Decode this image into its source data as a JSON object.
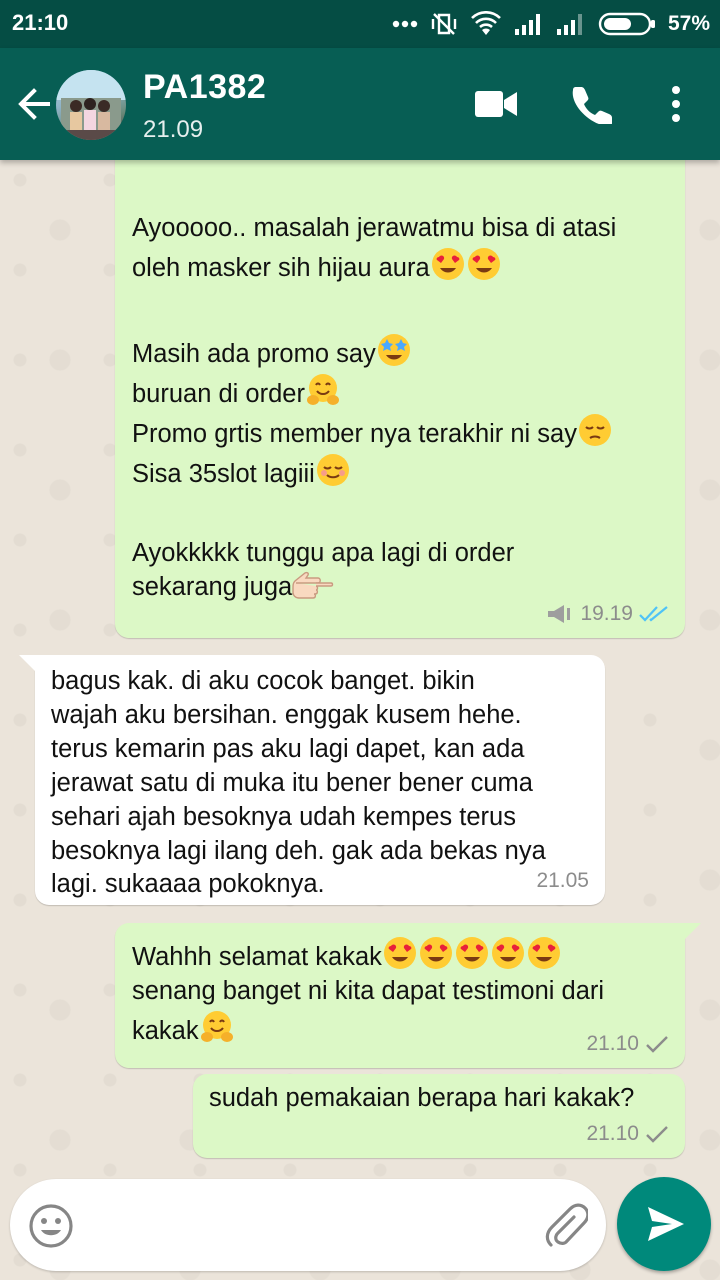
{
  "status_bar": {
    "time": "21:10",
    "battery": "57%"
  },
  "header": {
    "contact_name": "PA1382",
    "last_seen": "21.09"
  },
  "messages": [
    {
      "direction": "outgoing",
      "lines": [
        "Ayooooo.. masalah jerawatmu bisa di atasi",
        "oleh masker sih hijau aura",
        "",
        "Masih ada promo say",
        "buruan di order",
        "Promo grtis member nya terakhir ni say",
        "Sisa 35slot lagiii",
        "",
        "Ayokkkkk tunggu apa lagi di order",
        "sekarang juga"
      ],
      "time": "19.19",
      "status": "read"
    },
    {
      "direction": "incoming",
      "lines": [
        "bagus kak. di aku cocok banget. bikin",
        "wajah aku bersihan. enggak kusem hehe.",
        "terus kemarin pas aku lagi dapet, kan ada",
        "jerawat satu di muka itu bener bener cuma",
        "sehari ajah besoknya udah kempes terus",
        "besoknya lagi ilang deh. gak ada bekas nya",
        "lagi. sukaaaa pokoknya."
      ],
      "time": "21.05"
    },
    {
      "direction": "outgoing",
      "lines": [
        "Wahhh selamat kakak",
        "senang banget ni kita dapat testimoni dari",
        "kakak"
      ],
      "time": "21.10",
      "status": "sent"
    },
    {
      "direction": "outgoing",
      "lines": [
        "sudah pemakaian berapa hari kakak?"
      ],
      "time": "21.10",
      "status": "sent"
    }
  ],
  "icons": {
    "back": "arrow-back-icon",
    "video": "video-call-icon",
    "call": "phone-icon",
    "menu": "more-vert-icon",
    "emoji": "emoji-icon",
    "attach": "paperclip-icon",
    "send": "send-icon"
  },
  "colors": {
    "app_bar": "#075e54",
    "status_bar": "#054d44",
    "outgoing_bubble": "#dcf8c6",
    "incoming_bubble": "#ffffff",
    "read_ticks": "#4fc3f7",
    "send_button": "#00897b"
  }
}
